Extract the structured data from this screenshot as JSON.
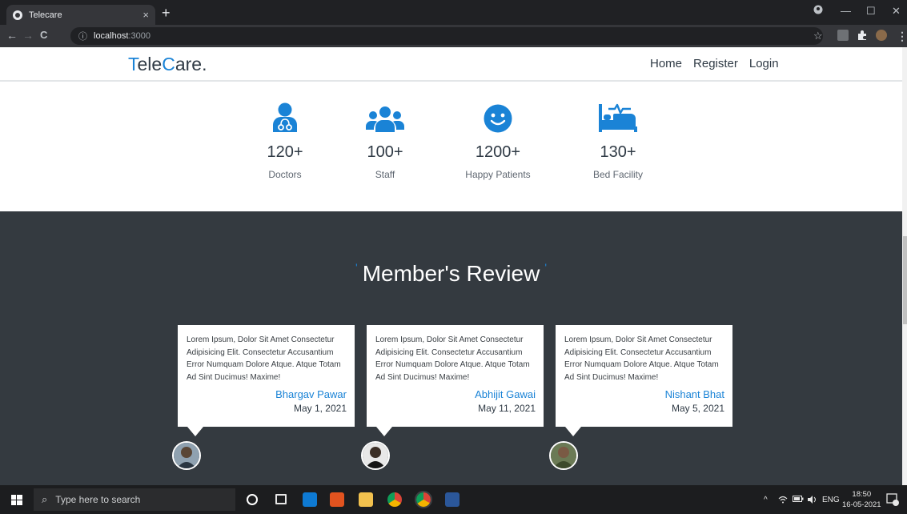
{
  "browser": {
    "tab_title": "Telecare",
    "tab_close": "×",
    "new_tab": "+",
    "url_host": "localhost",
    "url_port": ":3000",
    "nav": {
      "back": "←",
      "forward": "→",
      "reload": "C",
      "info": "ⓘ"
    },
    "window": {
      "minimize": "—",
      "maximize": "☐",
      "close": "✕"
    },
    "star": "☆",
    "menu": "⋮"
  },
  "site": {
    "logo": {
      "first_accent": "T",
      "part1": "ele",
      "second_accent": "C",
      "part2": "are."
    },
    "nav": [
      "Home",
      "Register",
      "Login"
    ]
  },
  "stats": [
    {
      "icon": "doctor-icon",
      "value": "120+",
      "label": "Doctors"
    },
    {
      "icon": "staff-icon",
      "value": "100+",
      "label": "Staff"
    },
    {
      "icon": "smile-icon",
      "value": "1200+",
      "label": "Happy Patients"
    },
    {
      "icon": "bed-icon",
      "value": "130+",
      "label": "Bed Facility"
    }
  ],
  "reviews": {
    "title": "Member's Review",
    "tick_left": "'",
    "tick_right": "'",
    "items": [
      {
        "text": "Lorem Ipsum, Dolor Sit Amet Consectetur Adipisicing Elit. Consectetur Accusantium Error Numquam Dolore Atque. Atque Totam Ad Sint Ducimus! Maxime!",
        "name": "Bhargav Pawar",
        "date": "May 1, 2021"
      },
      {
        "text": "Lorem Ipsum, Dolor Sit Amet Consectetur Adipisicing Elit. Consectetur Accusantium Error Numquam Dolore Atque. Atque Totam Ad Sint Ducimus! Maxime!",
        "name": "Abhijit Gawai",
        "date": "May 11, 2021"
      },
      {
        "text": "Lorem Ipsum, Dolor Sit Amet Consectetur Adipisicing Elit. Consectetur Accusantium Error Numquam Dolore Atque. Atque Totam Ad Sint Ducimus! Maxime!",
        "name": "Nishant Bhat",
        "date": "May 5, 2021"
      }
    ]
  },
  "taskbar": {
    "search_placeholder": "Type here to search",
    "tray_chevron": "^",
    "language": "ENG",
    "time": "18:50",
    "date": "16-05-2021",
    "notification_count": "2"
  },
  "colors": {
    "accent": "#1a83d6",
    "dark_section": "#343a40",
    "text": "#2f3a45"
  }
}
